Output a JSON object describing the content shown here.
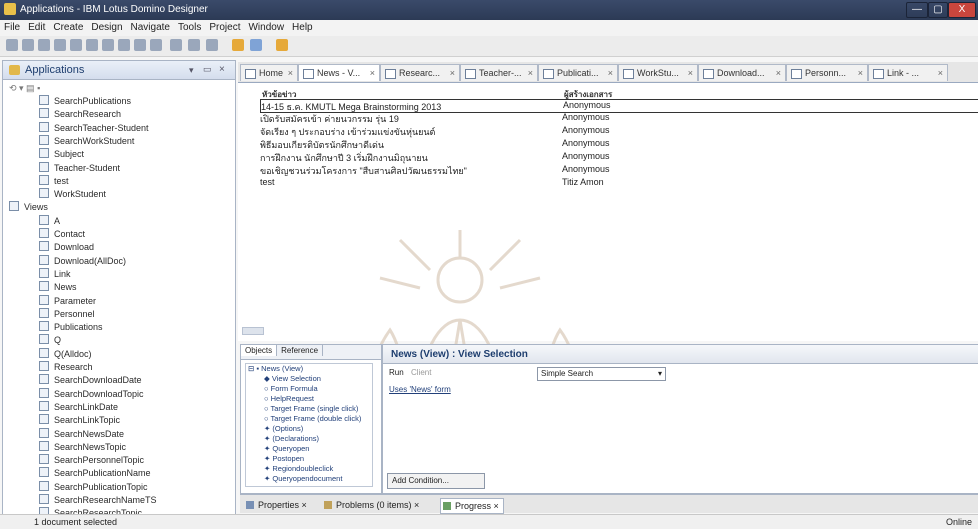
{
  "window": {
    "title": "Applications - IBM Lotus Domino Designer",
    "min": "—",
    "max": "▢",
    "close": "X"
  },
  "menu": [
    "File",
    "Edit",
    "Create",
    "Design",
    "Navigate",
    "Tools",
    "Project",
    "Window",
    "Help"
  ],
  "left_panel": {
    "title": "Applications",
    "items": [
      {
        "label": "SearchPublications",
        "indent": 2,
        "type": "form"
      },
      {
        "label": "SearchResearch",
        "indent": 2,
        "type": "form"
      },
      {
        "label": "SearchTeacher-Student",
        "indent": 2,
        "type": "form"
      },
      {
        "label": "SearchWorkStudent",
        "indent": 2,
        "type": "form"
      },
      {
        "label": "Subject",
        "indent": 2,
        "type": "form"
      },
      {
        "label": "Teacher-Student",
        "indent": 2,
        "type": "form"
      },
      {
        "label": "test",
        "indent": 2,
        "type": "form"
      },
      {
        "label": "WorkStudent",
        "indent": 2,
        "type": "form"
      },
      {
        "label": "Views",
        "indent": 1,
        "type": "folder"
      },
      {
        "label": "A",
        "indent": 2,
        "type": "view"
      },
      {
        "label": "Contact",
        "indent": 2,
        "type": "view"
      },
      {
        "label": "Download",
        "indent": 2,
        "type": "view"
      },
      {
        "label": "Download(AllDoc)",
        "indent": 2,
        "type": "view"
      },
      {
        "label": "Link",
        "indent": 2,
        "type": "view"
      },
      {
        "label": "News",
        "indent": 2,
        "type": "view"
      },
      {
        "label": "Parameter",
        "indent": 2,
        "type": "view"
      },
      {
        "label": "Personnel",
        "indent": 2,
        "type": "view"
      },
      {
        "label": "Publications",
        "indent": 2,
        "type": "view"
      },
      {
        "label": "Q",
        "indent": 2,
        "type": "view"
      },
      {
        "label": "Q(Alldoc)",
        "indent": 2,
        "type": "view"
      },
      {
        "label": "Research",
        "indent": 2,
        "type": "view"
      },
      {
        "label": "SearchDownloadDate",
        "indent": 2,
        "type": "view"
      },
      {
        "label": "SearchDownloadTopic",
        "indent": 2,
        "type": "view"
      },
      {
        "label": "SearchLinkDate",
        "indent": 2,
        "type": "view"
      },
      {
        "label": "SearchLinkTopic",
        "indent": 2,
        "type": "view"
      },
      {
        "label": "SearchNewsDate",
        "indent": 2,
        "type": "view"
      },
      {
        "label": "SearchNewsTopic",
        "indent": 2,
        "type": "view"
      },
      {
        "label": "SearchPersonnelTopic",
        "indent": 2,
        "type": "view"
      },
      {
        "label": "SearchPublicationName",
        "indent": 2,
        "type": "view"
      },
      {
        "label": "SearchPublicationTopic",
        "indent": 2,
        "type": "view"
      },
      {
        "label": "SearchResearchNameTS",
        "indent": 2,
        "type": "view"
      },
      {
        "label": "SearchResearchTopic",
        "indent": 2,
        "type": "view"
      }
    ]
  },
  "tabs": [
    {
      "label": "Home"
    },
    {
      "label": "News - V..."
    },
    {
      "label": "Researc..."
    },
    {
      "label": "Teacher-..."
    },
    {
      "label": "Publicati..."
    },
    {
      "label": "WorkStu..."
    },
    {
      "label": "Download..."
    },
    {
      "label": "Personn..."
    },
    {
      "label": "Link - ..."
    }
  ],
  "view": {
    "col_subject": "หัวข้อข่าว",
    "col_author": "ผู้สร้างเอกสาร",
    "rows": [
      {
        "subject": "14-15 ธ.ค. KMUTL Mega Brainstorming 2013",
        "author": "Anonymous",
        "selected": true
      },
      {
        "subject": "เปิดรับสมัครเข้า ค่ายนวกรรม รุ่น 19",
        "author": "Anonymous"
      },
      {
        "subject": "จัดเรียง ๆ ประกอบร่าง เข้าร่วมแข่งขันหุ่นยนต์",
        "author": "Anonymous"
      },
      {
        "subject": "พิธีมอบเกียรติบัตรนักศึกษาดีเด่น",
        "author": "Anonymous"
      },
      {
        "subject": "การฝึกงาน นักศึกษาปี 3 เริ่มฝึกงานมิถุนายน",
        "author": "Anonymous"
      },
      {
        "subject": "ขอเชิญชวนร่วมโครงการ \"สืบสานศิลปวัฒนธรรมไทย\"",
        "author": "Anonymous"
      },
      {
        "subject": "test",
        "author": "Titiz Amon"
      }
    ]
  },
  "objects_panel": {
    "tab_objects": "Objects",
    "tab_reference": "Reference",
    "items": [
      {
        "label": "News (View)",
        "kind": "root"
      },
      {
        "label": "View Selection",
        "kind": "bullet"
      },
      {
        "label": "Form Formula",
        "kind": "circle"
      },
      {
        "label": "HelpRequest",
        "kind": "circle"
      },
      {
        "label": "Target Frame (single click)",
        "kind": "circle"
      },
      {
        "label": "Target Frame (double click)",
        "kind": "circle"
      },
      {
        "label": "(Options)",
        "kind": "lotus"
      },
      {
        "label": "(Declarations)",
        "kind": "lotus"
      },
      {
        "label": "Queryopen",
        "kind": "lotus"
      },
      {
        "label": "Postopen",
        "kind": "lotus"
      },
      {
        "label": "Regiondoubleclick",
        "kind": "lotus"
      },
      {
        "label": "Queryopendocument",
        "kind": "lotus"
      }
    ]
  },
  "editor": {
    "title": "News (View) : View Selection",
    "run_label": "Run",
    "run_value": "Client",
    "search_mode": "Simple Search",
    "condition": "Uses 'News' form",
    "add_condition": "Add Condition..."
  },
  "bottom_tabs": [
    {
      "label": "Properties"
    },
    {
      "label": "Problems (0 items)"
    },
    {
      "label": "Progress"
    }
  ],
  "status": {
    "left": "1 document selected",
    "right": "Online"
  }
}
